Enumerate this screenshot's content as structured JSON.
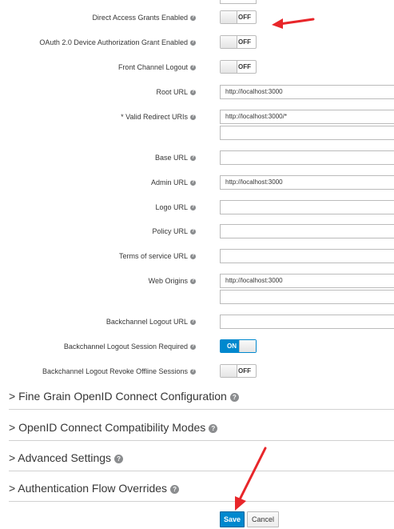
{
  "fields": {
    "direct_access": {
      "label": "Direct Access Grants Enabled",
      "value": "OFF"
    },
    "device_auth": {
      "label": "OAuth 2.0 Device Authorization Grant Enabled",
      "value": "OFF"
    },
    "front_channel": {
      "label": "Front Channel Logout",
      "value": "OFF"
    },
    "root_url": {
      "label": "Root URL",
      "value": "http://localhost:3000"
    },
    "redirect_uris": {
      "label": "* Valid Redirect URIs",
      "value": "http://localhost:3000/*",
      "extra_value": ""
    },
    "base_url": {
      "label": "Base URL",
      "value": ""
    },
    "admin_url": {
      "label": "Admin URL",
      "value": "http://localhost:3000"
    },
    "logo_url": {
      "label": "Logo URL",
      "value": ""
    },
    "policy_url": {
      "label": "Policy URL",
      "value": ""
    },
    "tos_url": {
      "label": "Terms of service URL",
      "value": ""
    },
    "web_origins": {
      "label": "Web Origins",
      "value": "http://localhost:3000",
      "extra_value": ""
    },
    "backchannel_url": {
      "label": "Backchannel Logout URL",
      "value": ""
    },
    "backchannel_session": {
      "label": "Backchannel Logout Session Required",
      "value": "ON"
    },
    "backchannel_revoke": {
      "label": "Backchannel Logout Revoke Offline Sessions",
      "value": "OFF"
    }
  },
  "sections": [
    {
      "label": "> Fine Grain OpenID Connect Configuration"
    },
    {
      "label": "> OpenID Connect Compatibility Modes"
    },
    {
      "label": "> Advanced Settings"
    },
    {
      "label": "> Authentication Flow Overrides"
    }
  ],
  "actions": {
    "save": "Save",
    "cancel": "Cancel"
  },
  "help_glyph": "?",
  "colors": {
    "accent": "#0088ce",
    "arrow": "#e8262a"
  }
}
